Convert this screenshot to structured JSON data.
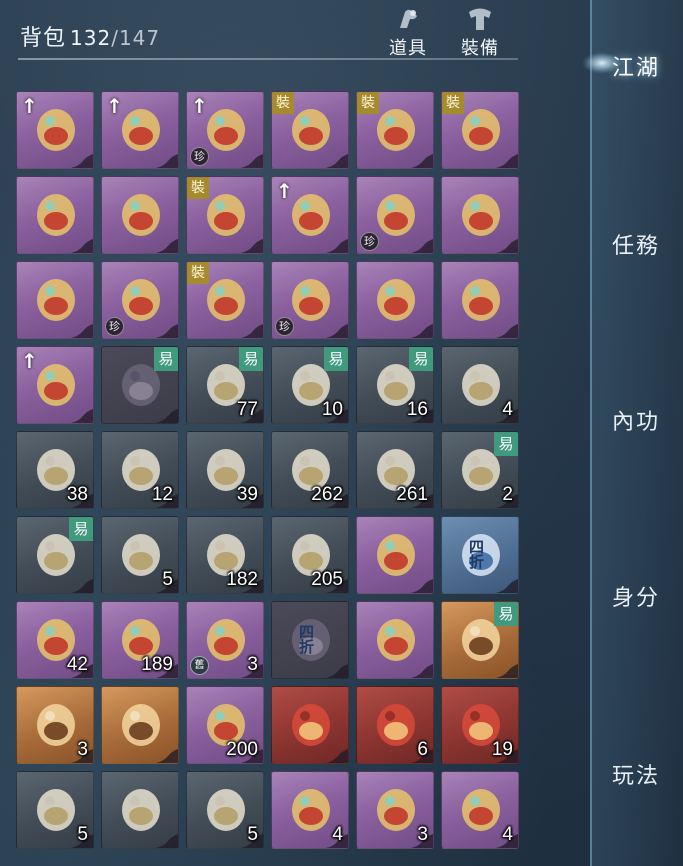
{
  "header": {
    "title": "背包",
    "count": "132",
    "max": "/147",
    "tabs": [
      {
        "label": "道具",
        "icon": "items-icon"
      },
      {
        "label": "裝備",
        "icon": "equipment-icon"
      }
    ]
  },
  "sidebar": {
    "items": [
      {
        "label": "江湖",
        "active": true
      },
      {
        "label": "任務",
        "active": false
      },
      {
        "label": "內功",
        "active": false
      },
      {
        "label": "身分",
        "active": false
      },
      {
        "label": "玩法",
        "active": false
      }
    ]
  },
  "badges": {
    "up": "↑",
    "equip": "裝",
    "trade": "易",
    "rare": "珍",
    "old": "舊"
  },
  "colors": {
    "purple_slot": "#8b619f",
    "dark_slot": "#424c56",
    "gold_slot": "#a86b3a",
    "red_slot": "#8c3531",
    "blue_slot": "#4f6f93",
    "equip_badge": "#a68a2e",
    "trade_badge": "#3f9a7e"
  },
  "grid": [
    [
      {
        "icon": "necklace-icon",
        "bg": "purple",
        "badges": [
          "up"
        ],
        "qty": ""
      },
      {
        "icon": "necklace-icon",
        "bg": "purple",
        "badges": [
          "up"
        ],
        "qty": ""
      },
      {
        "icon": "bead-necklace-icon",
        "bg": "purple",
        "badges": [
          "up",
          "rare"
        ],
        "qty": ""
      },
      {
        "icon": "gold-bracelet-icon",
        "bg": "purple",
        "badges": [
          "equip"
        ],
        "qty": ""
      },
      {
        "icon": "gold-bracelet-icon",
        "bg": "purple",
        "badges": [
          "equip"
        ],
        "qty": ""
      },
      {
        "icon": "ring-icon",
        "bg": "purple",
        "badges": [
          "equip"
        ],
        "qty": ""
      }
    ],
    [
      {
        "icon": "boots-icon",
        "bg": "purple",
        "badges": [],
        "qty": ""
      },
      {
        "icon": "bracer-icon",
        "bg": "purple",
        "badges": [],
        "qty": ""
      },
      {
        "icon": "headpiece-icon",
        "bg": "purple",
        "badges": [
          "equip"
        ],
        "qty": ""
      },
      {
        "icon": "headpiece-icon",
        "bg": "purple",
        "badges": [
          "up"
        ],
        "qty": ""
      },
      {
        "icon": "shoulder-armor-icon",
        "bg": "purple",
        "badges": [
          "rare"
        ],
        "qty": ""
      },
      {
        "icon": "robe-icon",
        "bg": "purple",
        "badges": [],
        "qty": ""
      }
    ],
    [
      {
        "icon": "jacket-icon",
        "bg": "purple",
        "badges": [],
        "qty": ""
      },
      {
        "icon": "blue-robe-icon",
        "bg": "purple",
        "badges": [
          "rare"
        ],
        "qty": ""
      },
      {
        "icon": "gauntlet-icon",
        "bg": "purple",
        "badges": [
          "equip"
        ],
        "qty": ""
      },
      {
        "icon": "horned-helm-icon",
        "bg": "purple",
        "badges": [
          "rare"
        ],
        "qty": ""
      },
      {
        "icon": "gauntlet-icon",
        "bg": "purple",
        "badges": [],
        "qty": ""
      },
      {
        "icon": "gauntlet-icon",
        "bg": "purple",
        "badges": [],
        "qty": ""
      }
    ],
    [
      {
        "icon": "fan-weapon-icon",
        "bg": "purple",
        "badges": [
          "up"
        ],
        "qty": ""
      },
      {
        "icon": "tassel-icon",
        "bg": "faded",
        "badges": [
          "trade"
        ],
        "qty": ""
      },
      {
        "icon": "wine-jar-icon",
        "bg": "dark",
        "badges": [
          "trade"
        ],
        "qty": "77"
      },
      {
        "icon": "clay-jar-icon",
        "bg": "dark",
        "badges": [
          "trade"
        ],
        "qty": "10"
      },
      {
        "icon": "wine-jar-icon",
        "bg": "dark",
        "badges": [
          "trade"
        ],
        "qty": "16"
      },
      {
        "icon": "clay-jar-icon",
        "bg": "dark",
        "badges": [],
        "qty": "4"
      }
    ],
    [
      {
        "icon": "gourd-bottle-icon",
        "bg": "dark",
        "badges": [],
        "qty": "38"
      },
      {
        "icon": "gourd-bottle-icon",
        "bg": "dark",
        "badges": [],
        "qty": "12"
      },
      {
        "icon": "porcelain-flask-icon",
        "bg": "dark",
        "badges": [],
        "qty": "39"
      },
      {
        "icon": "powder-packet-icon",
        "bg": "dark",
        "badges": [],
        "qty": "262"
      },
      {
        "icon": "powder-packet-icon",
        "bg": "dark",
        "badges": [],
        "qty": "261"
      },
      {
        "icon": "teapot-icon",
        "bg": "dark",
        "badges": [
          "trade"
        ],
        "qty": "2"
      }
    ],
    [
      {
        "icon": "jade-teaset-icon",
        "bg": "dark",
        "badges": [
          "trade"
        ],
        "qty": ""
      },
      {
        "icon": "soup-bowl-icon",
        "bg": "dark",
        "badges": [],
        "qty": "5"
      },
      {
        "icon": "soup-bowl-icon",
        "bg": "dark",
        "badges": [],
        "qty": "182"
      },
      {
        "icon": "soup-bowl-icon",
        "bg": "dark",
        "badges": [],
        "qty": "205"
      },
      {
        "icon": "sack-icon",
        "bg": "purple",
        "badges": [],
        "qty": ""
      },
      {
        "icon": "coupon-icon",
        "bg": "blue",
        "badges": [],
        "qty": "",
        "text": "四折"
      }
    ],
    [
      {
        "icon": "scroll-icon",
        "bg": "purple",
        "badges": [],
        "qty": "42"
      },
      {
        "icon": "jade-seal-icon",
        "bg": "purple",
        "badges": [],
        "qty": "189"
      },
      {
        "icon": "jade-dragon-icon",
        "bg": "purple",
        "badges": [
          "old"
        ],
        "qty": "3"
      },
      {
        "icon": "coupon-icon",
        "bg": "faded",
        "badges": [],
        "qty": "",
        "text": "四折"
      },
      {
        "icon": "penguin-icon",
        "bg": "purple",
        "badges": [],
        "qty": ""
      },
      {
        "icon": "slingshot-icon",
        "bg": "gold",
        "badges": [
          "trade"
        ],
        "qty": ""
      }
    ],
    [
      {
        "icon": "calligraphy-brush-icon",
        "bg": "gold",
        "badges": [],
        "qty": "3"
      },
      {
        "icon": "fox-plush-icon",
        "bg": "gold",
        "badges": [],
        "qty": ""
      },
      {
        "icon": "shell-icon",
        "bg": "purple",
        "badges": [],
        "qty": "200"
      },
      {
        "icon": "gift-box-icon",
        "bg": "red",
        "badges": [],
        "qty": ""
      },
      {
        "icon": "firecracker-icon",
        "bg": "red",
        "badges": [],
        "qty": "6"
      },
      {
        "icon": "firecracker-icon",
        "bg": "red",
        "badges": [],
        "qty": "19"
      }
    ],
    [
      {
        "icon": "paper-scroll-icon",
        "bg": "dark",
        "badges": [],
        "qty": "5"
      },
      {
        "icon": "dragon-boat-icon",
        "bg": "dark",
        "badges": [],
        "qty": ""
      },
      {
        "icon": "paper-scroll-icon",
        "bg": "dark",
        "badges": [],
        "qty": "5"
      },
      {
        "icon": "rolled-scroll-icon",
        "bg": "purple",
        "badges": [],
        "qty": "4"
      },
      {
        "icon": "bronze-coin-icon",
        "bg": "purple",
        "badges": [],
        "qty": "3"
      },
      {
        "icon": "crystal-icon",
        "bg": "purple",
        "badges": [],
        "qty": "4"
      }
    ]
  ]
}
